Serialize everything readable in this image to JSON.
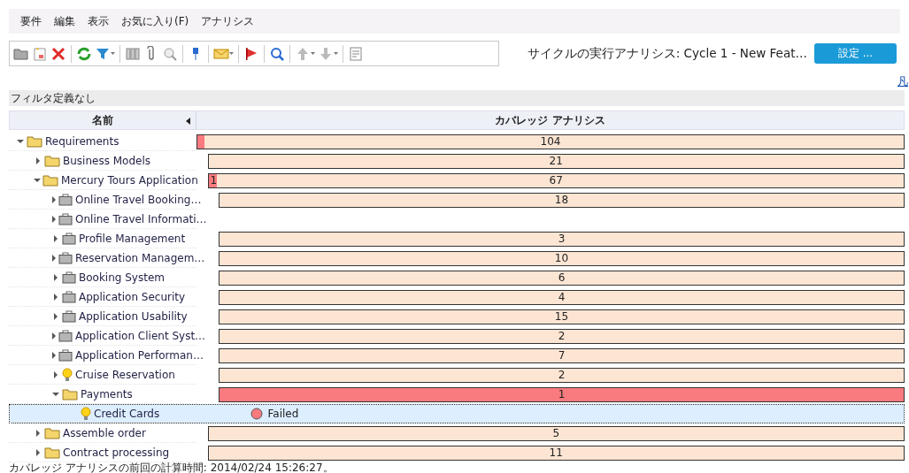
{
  "menu": [
    "要件",
    "編集",
    "表示",
    "お気に入り(F)",
    "アナリシス"
  ],
  "cycle_label": "サイクルの実行アナリシス: Cycle 1 - New Feat…",
  "settings_button": "設定 ...",
  "legend_link": "凡",
  "filter_bar": "フィルタ定義なし",
  "columns": [
    "名前",
    "カバレッジ アナリシス"
  ],
  "tree": [
    {
      "name": "Requirements",
      "kind": "folder",
      "expandable": true,
      "expanded": true,
      "selected": false,
      "coverage": {
        "label": "104",
        "level": 0.01
      },
      "children": [
        {
          "name": "Business Models",
          "kind": "folder",
          "expandable": true,
          "expanded": false,
          "selected": false,
          "coverage": {
            "label": "21"
          }
        },
        {
          "name": "Mercury Tours Application",
          "kind": "folder",
          "expandable": true,
          "expanded": true,
          "selected": false,
          "coverage": {
            "label": "67",
            "level": 0.012,
            "failed_label": "1"
          },
          "children": [
            {
              "name": "Online Travel Booking…",
              "kind": "group",
              "expandable": true,
              "expanded": false,
              "selected": false,
              "coverage": {
                "label": "18"
              }
            },
            {
              "name": "Online Travel Informati…",
              "kind": "group",
              "expandable": true,
              "expanded": false,
              "selected": false
            },
            {
              "name": "Profile Management",
              "kind": "group",
              "expandable": true,
              "expanded": false,
              "selected": false,
              "coverage": {
                "label": "3"
              }
            },
            {
              "name": "Reservation  Managem…",
              "kind": "group",
              "expandable": true,
              "expanded": false,
              "selected": false,
              "coverage": {
                "label": "10"
              }
            },
            {
              "name": "Booking System",
              "kind": "group",
              "expandable": true,
              "expanded": false,
              "selected": false,
              "coverage": {
                "label": "6"
              }
            },
            {
              "name": "Application Security",
              "kind": "group",
              "expandable": true,
              "expanded": false,
              "selected": false,
              "coverage": {
                "label": "4"
              }
            },
            {
              "name": "Application Usability",
              "kind": "group",
              "expandable": true,
              "expanded": false,
              "selected": false,
              "coverage": {
                "label": "15"
              }
            },
            {
              "name": "Application Client Syst…",
              "kind": "group",
              "expandable": true,
              "expanded": false,
              "selected": false,
              "coverage": {
                "label": "2"
              }
            },
            {
              "name": "Application  Performan…",
              "kind": "group",
              "expandable": true,
              "expanded": false,
              "selected": false,
              "coverage": {
                "label": "7"
              }
            },
            {
              "name": "Cruise Reservation",
              "kind": "requirement",
              "expandable": true,
              "expanded": false,
              "selected": false,
              "coverage": {
                "label": "2"
              }
            },
            {
              "name": "Payments",
              "kind": "folder",
              "expandable": true,
              "expanded": true,
              "selected": false,
              "coverage": {
                "label": "1",
                "level": 1
              },
              "children": [
                {
                  "name": "Credit Cards",
                  "kind": "requirement",
                  "expandable": false,
                  "selected": true,
                  "status": {
                    "kind": "failed",
                    "label": "Failed"
                  }
                }
              ]
            }
          ]
        },
        {
          "name": "Assemble order",
          "kind": "folder",
          "expandable": true,
          "expanded": false,
          "selected": false,
          "coverage": {
            "label": "5"
          }
        },
        {
          "name": "Contract processing",
          "kind": "folder",
          "expandable": true,
          "expanded": false,
          "selected": false,
          "coverage": {
            "label": "11"
          }
        }
      ]
    }
  ],
  "status_bar": "カバレッジ アナリシスの前回の計算時間: 2014/02/24 15:26:27。"
}
